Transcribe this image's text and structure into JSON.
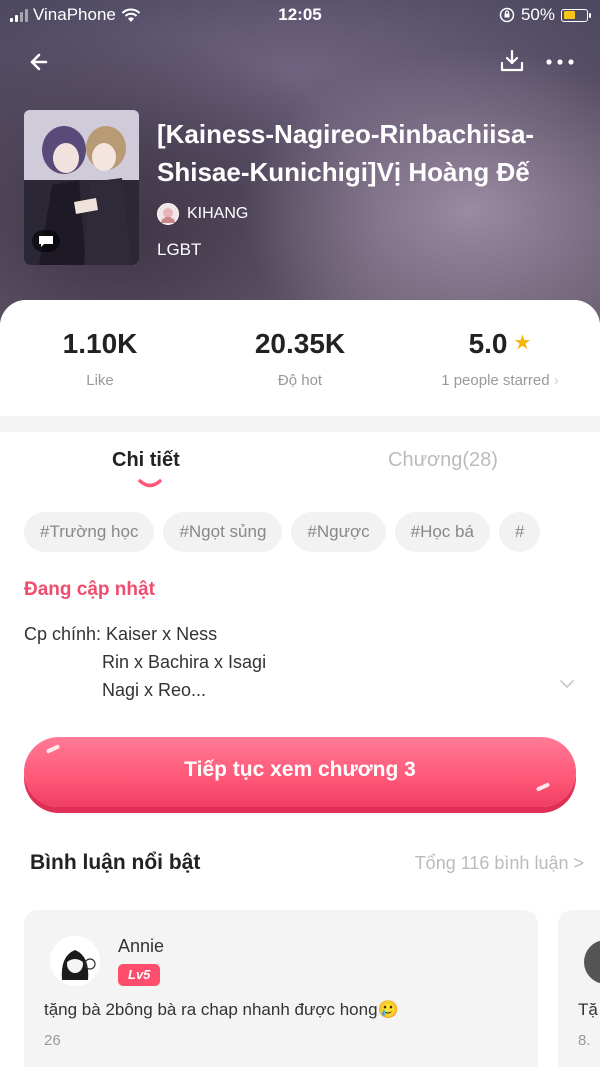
{
  "status_bar": {
    "carrier": "VinaPhone",
    "time": "12:05",
    "battery": "50%"
  },
  "header": {
    "title": "[Kainess-Nagireo-Rinbachiisa-Shisae-Kunichigi]Vị Hoàng Đế",
    "author": "KIHANG",
    "genre": "LGBT"
  },
  "stats": {
    "likes": {
      "value": "1.10K",
      "label": "Like"
    },
    "hot": {
      "value": "20.35K",
      "label": "Độ hot"
    },
    "rating": {
      "value": "5.0",
      "label": "1 people starred"
    }
  },
  "tabs": {
    "details": "Chi tiết",
    "chapters": "Chương(28)"
  },
  "tags": [
    "#Trường học",
    "#Ngọt sủng",
    "#Ngược",
    "#Học bá",
    "#"
  ],
  "status_text": "Đang cập nhật",
  "description": {
    "line1": "Cp chính: Kaiser x Ness",
    "line2": "Rin x Bachira x Isagi",
    "line3": "Nagi x Reo..."
  },
  "cta_label": "Tiếp tục xem chương 3",
  "comments_section": {
    "title": "Bình luận nổi bật",
    "total": "Tổng 116 bình luận >",
    "comments": [
      {
        "user": "Annie",
        "level": "Lv5",
        "text": "tặng bà 2bông bà ra chap nhanh được hong🥲",
        "count": "26"
      },
      {
        "text": "Tặ",
        "count": "8."
      }
    ]
  },
  "colors": {
    "accent": "#ff5777",
    "status_red": "#ee4d6e",
    "star": "#f7b500"
  }
}
